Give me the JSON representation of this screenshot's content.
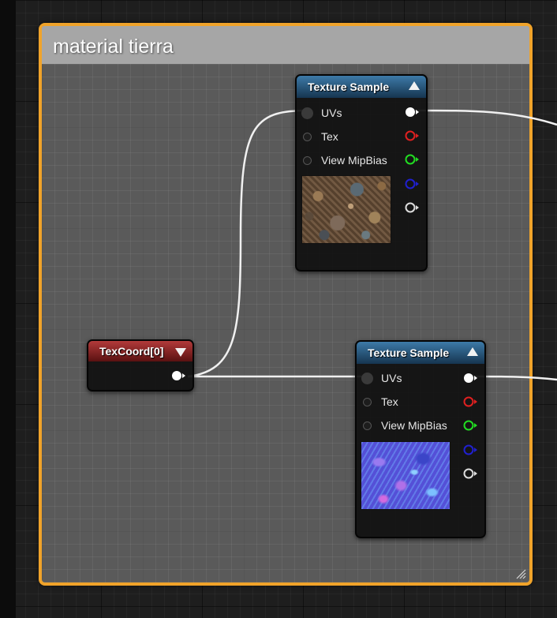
{
  "comment_box": {
    "title": "material tierra"
  },
  "nodes": {
    "texture_sample_1": {
      "title": "Texture Sample",
      "inputs": [
        "UVs",
        "Tex",
        "View MipBias"
      ],
      "preview": "dirt-ground-texture"
    },
    "texture_sample_2": {
      "title": "Texture Sample",
      "inputs": [
        "UVs",
        "Tex",
        "View MipBias"
      ],
      "preview": "normal-map-texture"
    },
    "texcoord": {
      "title": "TexCoord[0]"
    }
  },
  "pin_colors": {
    "rgb": "#ffffff",
    "r": "#e02020",
    "g": "#22dd22",
    "b": "#2020d0",
    "a": "#dddddd"
  },
  "colors": {
    "comment_border": "#f0a32a",
    "comment_title_bar": "#a6a6a6",
    "texture_header": "#2a5b86",
    "texcoord_header": "#8e2525"
  }
}
